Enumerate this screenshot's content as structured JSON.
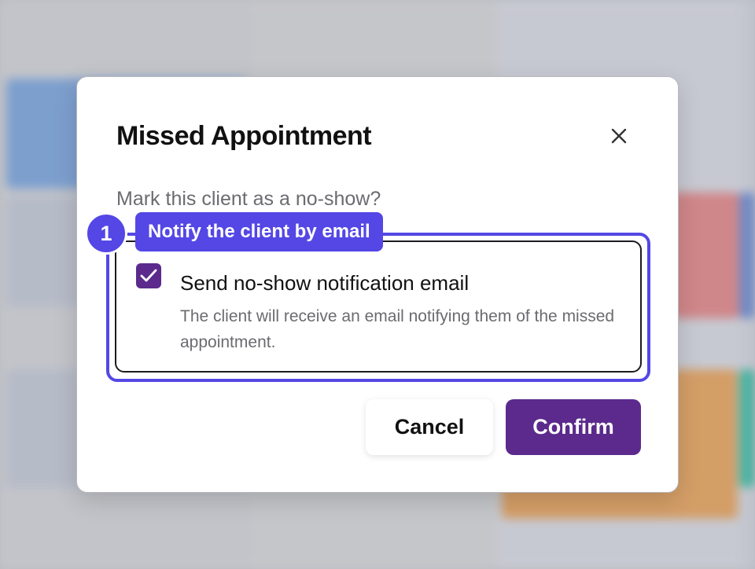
{
  "modal": {
    "title": "Missed Appointment",
    "prompt": "Mark this client as a no-show?",
    "close_icon": "close-icon"
  },
  "option": {
    "checked": true,
    "title": "Send no-show notification email",
    "description": "The client will receive an email notifying them of the missed appointment."
  },
  "annotation": {
    "step_number": "1",
    "label": "Notify the client by email"
  },
  "buttons": {
    "cancel_label": "Cancel",
    "confirm_label": "Confirm"
  },
  "colors": {
    "accent": "#5447e5",
    "primary": "#5b2a8c"
  }
}
